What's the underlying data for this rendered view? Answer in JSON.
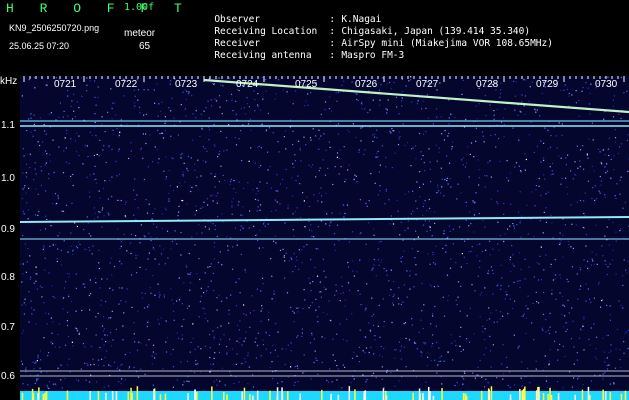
{
  "header": {
    "app_title": "H R O F F T",
    "version": "1.00f",
    "file_name": "KN9_2506250720.png",
    "datetime": "25.06.25 07:20",
    "meteor_label": "meteor",
    "meteor_count": "65",
    "info_rows": [
      {
        "label": "Observer",
        "sep": ":",
        "value": "K.Nagai"
      },
      {
        "label": "Receiving Location",
        "sep": ":",
        "value": "Chigasaki, Japan (139.414 35.340)"
      },
      {
        "label": "Receiver",
        "sep": ":",
        "value": "AirSpy mini (Miakejima VOR 108.65MHz)"
      },
      {
        "label": "Receiving antenna",
        "sep": ":",
        "value": "Maspro FM-3"
      }
    ]
  },
  "spectrogram": {
    "y_unit": "kHz",
    "y_ticks": [
      "1.1",
      "1.0",
      "0.9",
      "0.8",
      "0.7",
      "0.6"
    ],
    "x_ticks": [
      "0721",
      "0722",
      "0723",
      "0724",
      "0725",
      "0726",
      "0727",
      "0728",
      "0729",
      "0730"
    ],
    "colors": {
      "background": "#05062e",
      "noise": "#2a3bd0",
      "signal": "#9cf4ff",
      "meteor": "#c8ffd0",
      "bottom_band": "#1fd8ff",
      "bottom_spikes": "#ffff40"
    }
  }
}
